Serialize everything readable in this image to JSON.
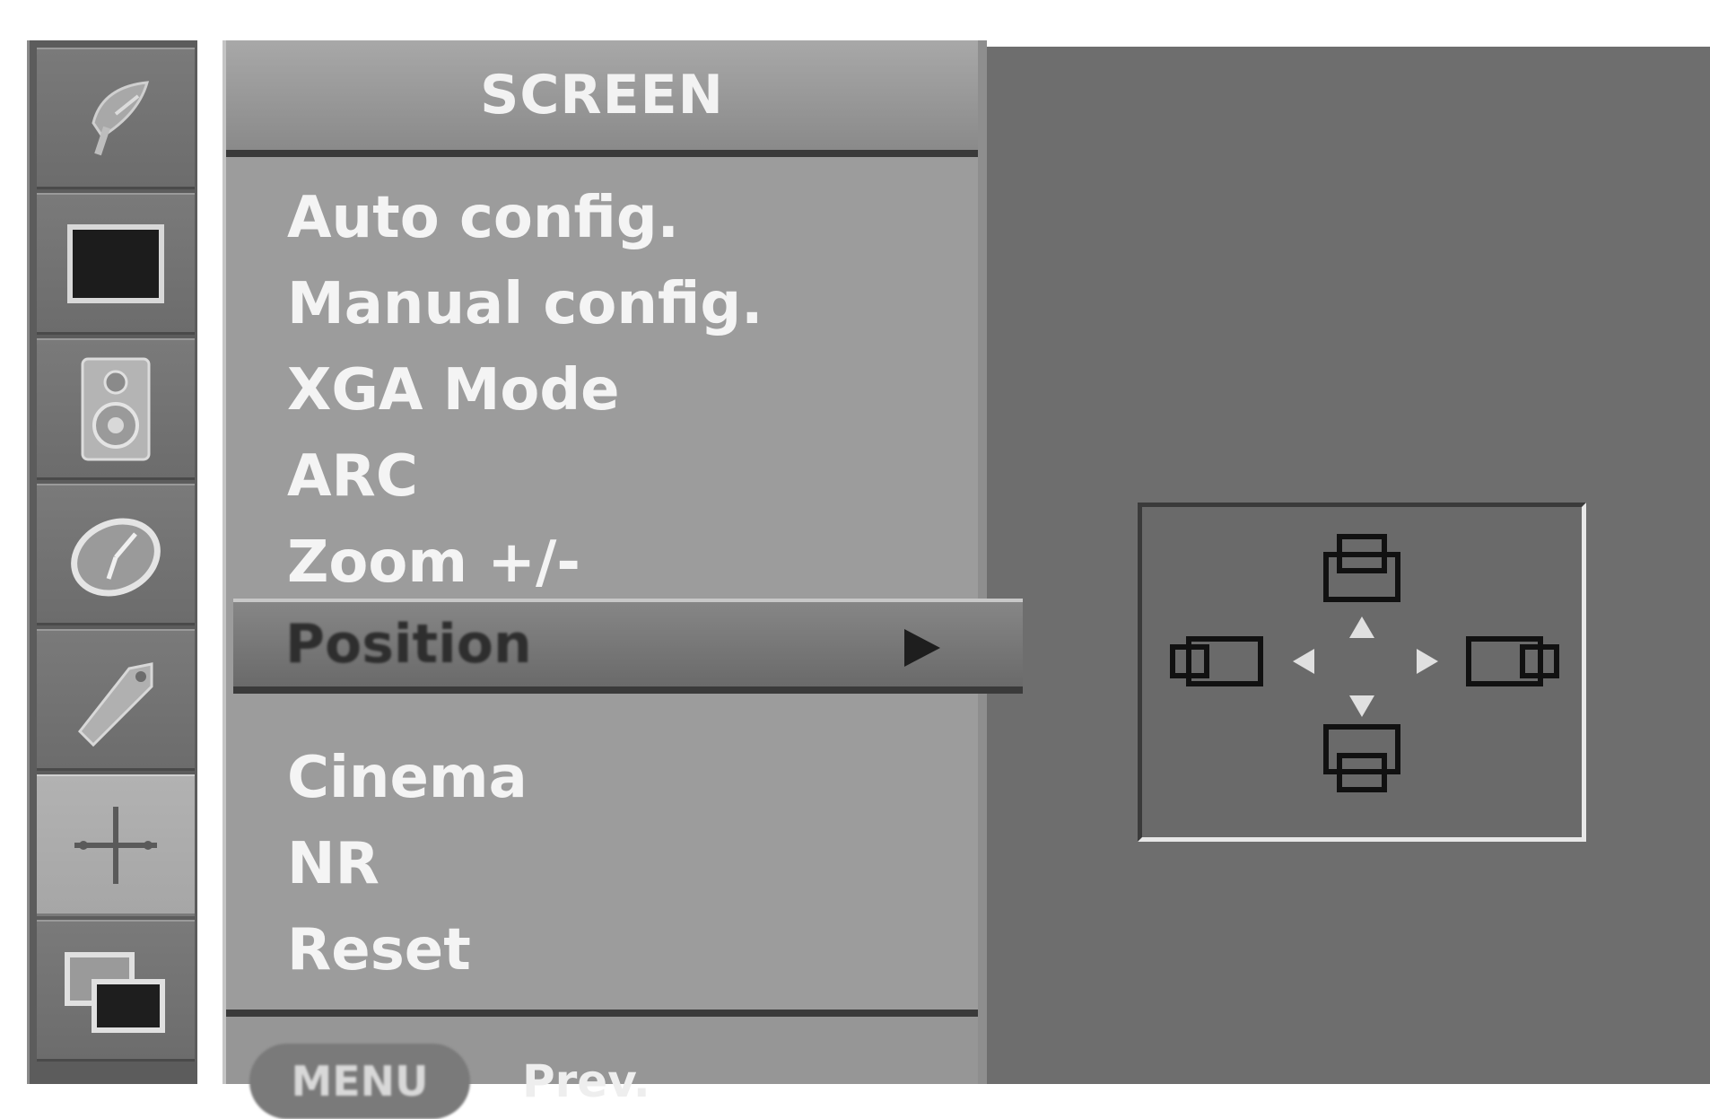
{
  "sidebar": {
    "items": [
      {
        "icon": "satellite-dish-icon",
        "active": false
      },
      {
        "icon": "picture-icon",
        "active": false
      },
      {
        "icon": "speaker-icon",
        "active": false
      },
      {
        "icon": "clock-icon",
        "active": false
      },
      {
        "icon": "tag-icon",
        "active": false
      },
      {
        "icon": "screen-move-icon",
        "active": true
      },
      {
        "icon": "pip-icon",
        "active": false
      }
    ]
  },
  "menu": {
    "title": "SCREEN",
    "items": [
      {
        "label": "Auto config."
      },
      {
        "label": "Manual config."
      },
      {
        "label": "XGA Mode"
      },
      {
        "label": "ARC"
      },
      {
        "label": "Zoom +/-"
      },
      {
        "label": "Position",
        "selected": true,
        "has_submenu": true
      },
      {
        "label": "Cinema"
      },
      {
        "label": "NR"
      },
      {
        "label": "Reset"
      }
    ],
    "footer": {
      "key_label": "MENU",
      "action_label": "Prev."
    }
  },
  "position_panel": {
    "icons": [
      "move-up-icon",
      "move-left-icon",
      "move-right-icon",
      "move-down-icon"
    ]
  },
  "colors": {
    "panel": "#9c9c9c",
    "selected_row": "#767676",
    "background": "#6e6e6e",
    "text": "#f4f4f4"
  }
}
